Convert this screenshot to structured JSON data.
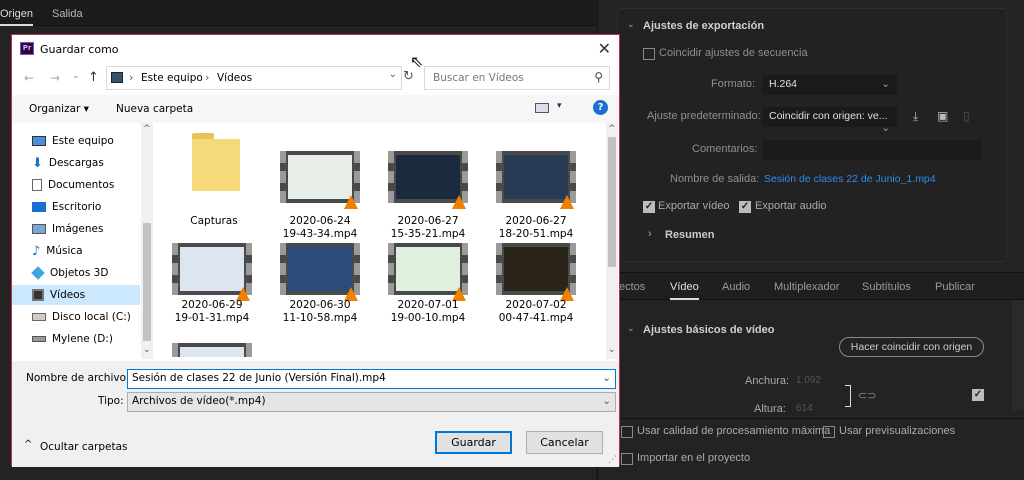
{
  "app": {
    "tabs": [
      "Origen",
      "Salida"
    ]
  },
  "export": {
    "section_title": "Ajustes de exportación",
    "match_sequence": "Coincidir ajustes de secuencia",
    "format_label": "Formato:",
    "format_value": "H.264",
    "preset_label": "Ajuste predeterminado:",
    "preset_value": "Coincidir con origen: ve...",
    "comments_label": "Comentarios:",
    "output_label": "Nombre de salida:",
    "output_value": "Sesión de clases 22 de Junio_1.mp4",
    "export_video": "Exportar vídeo",
    "export_audio": "Exportar audio",
    "summary": "Resumen",
    "tabs": [
      "ectos",
      "Vídeo",
      "Audio",
      "Multiplexador",
      "Subtítulos",
      "Publicar"
    ],
    "video_basic": "Ajustes básicos de vídeo",
    "match_source_btn": "Hacer coincidir con origen",
    "width_label": "Anchura:",
    "width_value": "1.092",
    "height_label": "Altura:",
    "height_value": "614",
    "max_quality": "Usar calidad de procesamiento máxima",
    "use_previews": "Usar previsualizaciones",
    "import_project": "Importar en el proyecto"
  },
  "dialog": {
    "title": "Guardar como",
    "breadcrumb": [
      "Este equipo",
      "Vídeos"
    ],
    "search_placeholder": "Buscar en Vídeos",
    "organize": "Organizar ▾",
    "new_folder": "Nueva carpeta",
    "nav_items": [
      "Este equipo",
      "Descargas",
      "Documentos",
      "Escritorio",
      "Imágenes",
      "Música",
      "Objetos 3D",
      "Vídeos",
      "Disco local (C:)",
      "Mylene (D:)"
    ],
    "files": [
      {
        "name": "Capturas",
        "type": "folder"
      },
      {
        "name": "2020-06-24\n19-43-34.mp4",
        "type": "video",
        "color": "#e8efe8"
      },
      {
        "name": "2020-06-27\n15-35-21.mp4",
        "type": "video",
        "color": "#1b2a3f"
      },
      {
        "name": "2020-06-27\n18-20-51.mp4",
        "type": "video",
        "color": "#2a3b55"
      },
      {
        "name": "2020-06-29\n19-01-31.mp4",
        "type": "video",
        "color": "#dde6f0"
      },
      {
        "name": "2020-06-30\n11-10-58.mp4",
        "type": "video",
        "color": "#2b4c7a"
      },
      {
        "name": "2020-07-01\n19-00-10.mp4",
        "type": "video",
        "color": "#dff0df"
      },
      {
        "name": "2020-07-02\n00-47-41.mp4",
        "type": "video",
        "color": "#2b2418"
      }
    ],
    "filename_label": "Nombre de archivo:",
    "filename_value": "Sesión de clases 22 de Junio (Versión Final).mp4",
    "type_label": "Tipo:",
    "type_value": "Archivos de vídeo(*.mp4)",
    "hide_folders": "Ocultar carpetas",
    "save": "Guardar",
    "cancel": "Cancelar"
  }
}
